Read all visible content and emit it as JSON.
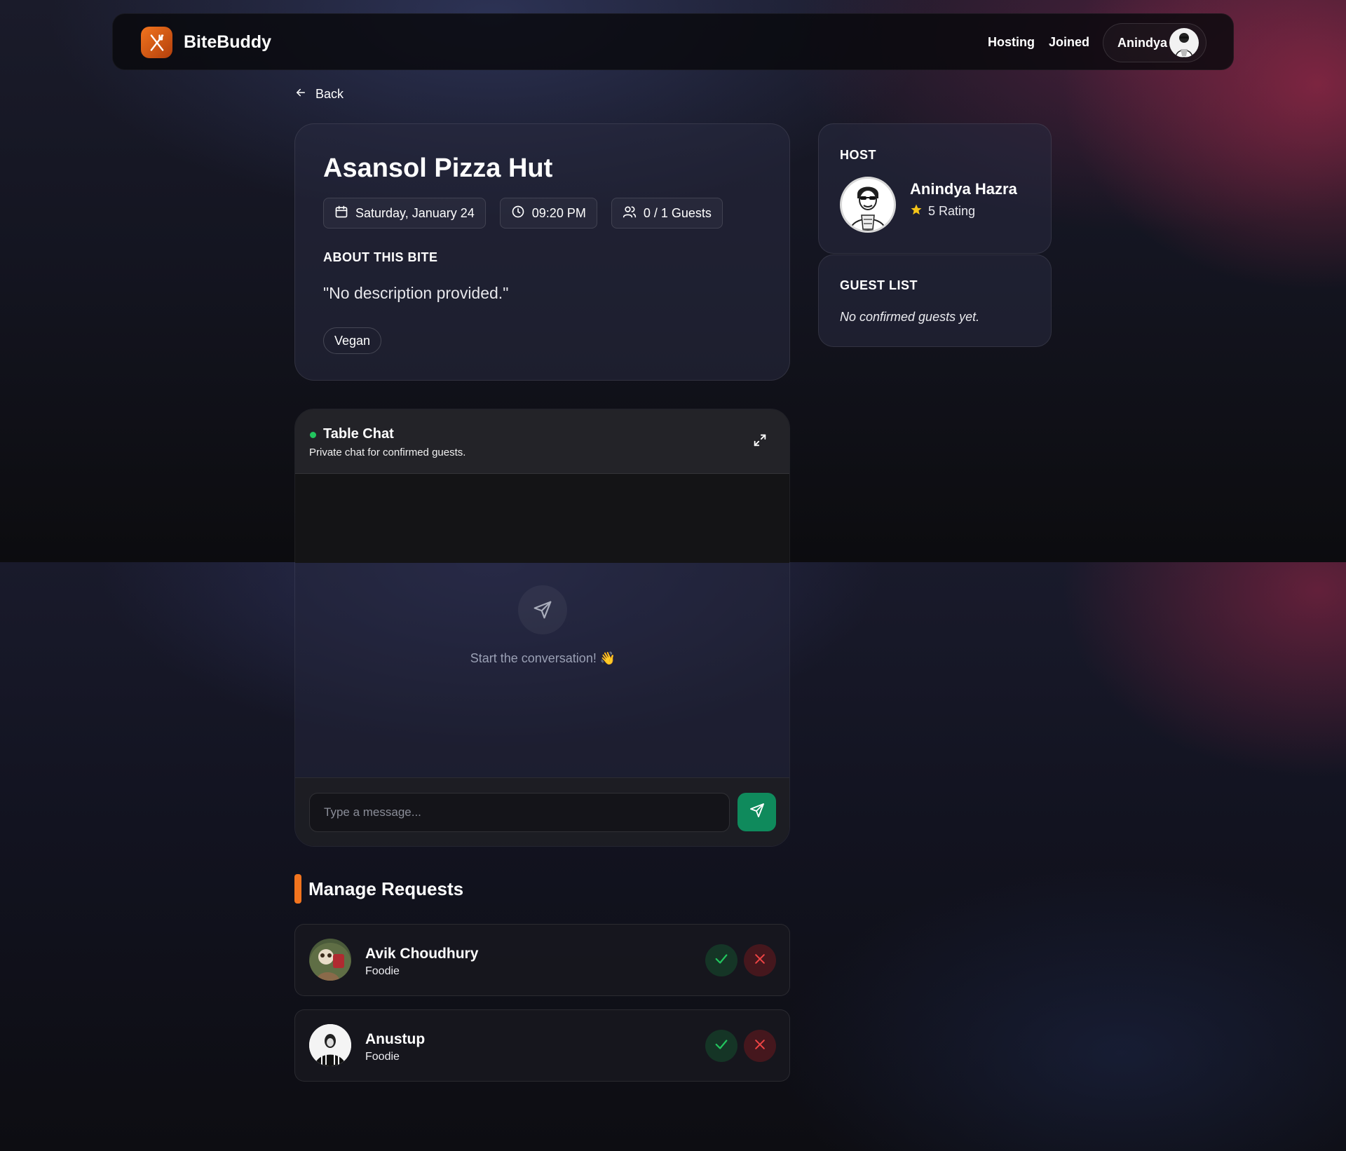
{
  "brand": {
    "name": "BiteBuddy",
    "logo_icon": "fork-knife-icon",
    "accent": "#f2741e"
  },
  "nav": {
    "links": [
      "Hosting",
      "Joined"
    ],
    "user_name": "Anindya"
  },
  "back": {
    "label": "Back"
  },
  "event": {
    "title": "Asansol Pizza Hut",
    "date": "Saturday, January 24",
    "time": "09:20 PM",
    "guests": "0 / 1 Guests",
    "about_heading": "ABOUT THIS BITE",
    "description": "\"No description provided.\"",
    "tags": [
      "Vegan"
    ]
  },
  "host": {
    "heading": "HOST",
    "name": "Anindya Hazra",
    "rating": "5 Rating"
  },
  "guest_list": {
    "heading": "GUEST LIST",
    "empty_text": "No confirmed guests yet."
  },
  "chat": {
    "title": "Table Chat",
    "subtitle": "Private chat for confirmed guests.",
    "empty_text": "Start the conversation! 👋",
    "input_placeholder": "Type a message...",
    "online_color": "#22c55e",
    "send_color": "#0f8a5c"
  },
  "requests": {
    "heading": "Manage Requests",
    "items": [
      {
        "name": "Avik Choudhury",
        "role": "Foodie"
      },
      {
        "name": "Anustup",
        "role": "Foodie"
      }
    ]
  }
}
